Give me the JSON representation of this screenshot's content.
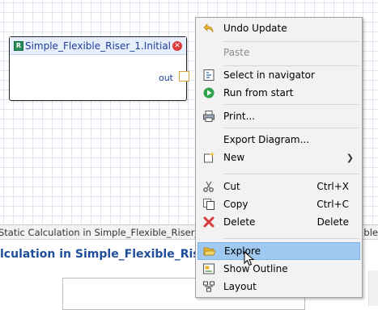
{
  "diagram": {
    "node_icon_letter": "R",
    "node_title": "Simple_Flexible_Riser_1.Initial",
    "port_label": "out"
  },
  "panel": {
    "tab_label": "Static Calculation in Simple_Flexible_Riser_1",
    "tab_close": "✕",
    "tab_right_fragment": "ble",
    "heading": "lculation in Simple_Flexible_Riser_1"
  },
  "context_menu": {
    "items": [
      {
        "label": "Undo Update",
        "icon": "undo-icon",
        "shortcut": ""
      },
      {
        "label": "Paste",
        "icon": "",
        "shortcut": "",
        "disabled": true
      },
      {
        "label": "Select in navigator",
        "icon": "navigator-icon",
        "shortcut": ""
      },
      {
        "label": "Run from start",
        "icon": "run-icon",
        "shortcut": ""
      },
      {
        "label": "Print...",
        "icon": "printer-icon",
        "shortcut": ""
      },
      {
        "label": "Export Diagram...",
        "icon": "",
        "shortcut": ""
      },
      {
        "label": "New",
        "icon": "new-icon",
        "shortcut": "",
        "submenu": true
      },
      {
        "label": "Cut",
        "icon": "scissors-icon",
        "shortcut": "Ctrl+X"
      },
      {
        "label": "Copy",
        "icon": "copy-icon",
        "shortcut": "Ctrl+C"
      },
      {
        "label": "Delete",
        "icon": "delete-icon",
        "shortcut": "Delete"
      },
      {
        "label": "Explore",
        "icon": "folder-open-icon",
        "shortcut": "",
        "highlighted": true
      },
      {
        "label": "Show Outline",
        "icon": "outline-icon",
        "shortcut": ""
      },
      {
        "label": "Layout",
        "icon": "layout-icon",
        "shortcut": ""
      }
    ]
  },
  "colors": {
    "highlight": "#9fc9f0",
    "node_title": "#1f3f99",
    "heading": "#1f4e9c"
  }
}
